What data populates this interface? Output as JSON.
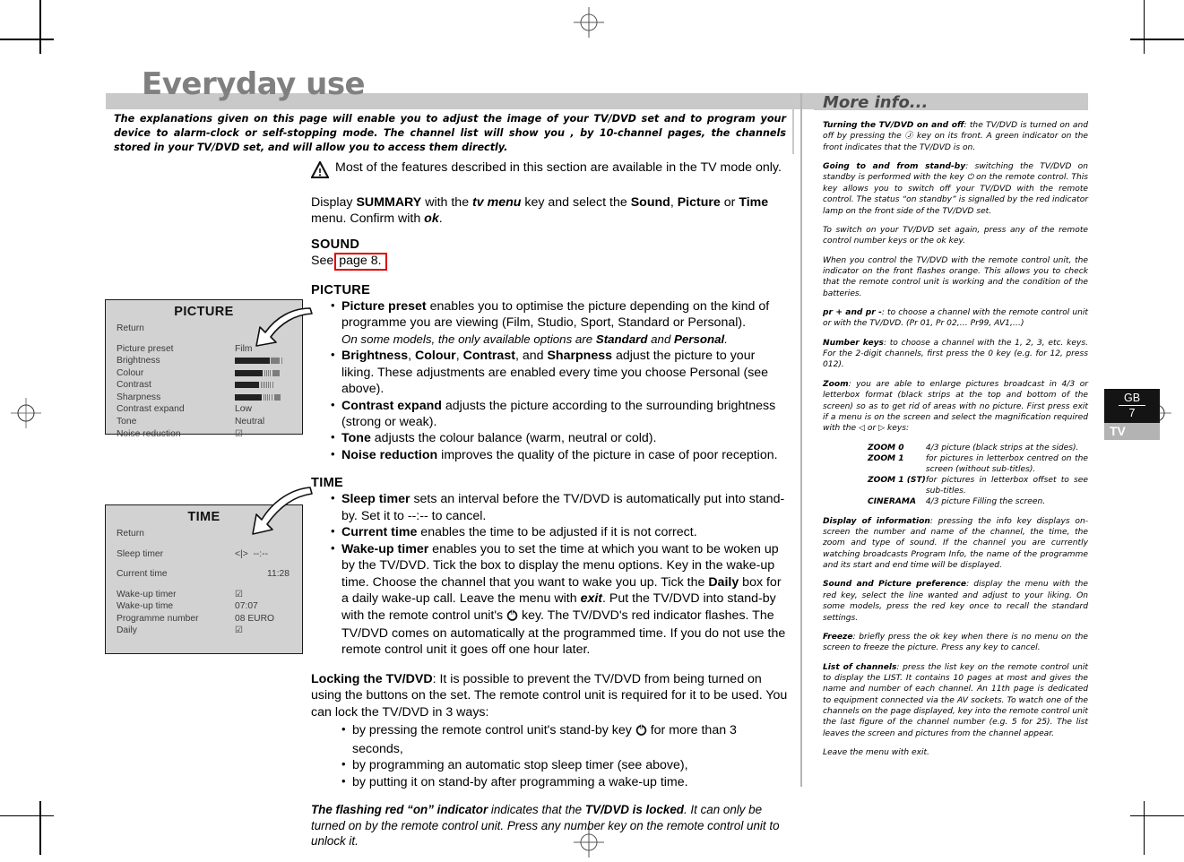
{
  "header": {
    "title": "Everyday use",
    "intro": "The explanations given on this page will enable you to adjust the image of your TV/DVD set and to program your device to alarm-clock or self-stopping mode.  The channel list will show you , by 10-channel pages, the channels stored in your TV/DVD set, and will allow you to access them directly."
  },
  "main": {
    "warning": "Most of the features described in this section are available in the TV mode only.",
    "display_line": {
      "p1": "Display ",
      "b1": "SUMMARY",
      "p2": " with the ",
      "b2": "tv menu",
      "p3": " key and select the ",
      "b3": "Sound",
      "p4": ", ",
      "b4": "Picture",
      "p5": " or ",
      "b5": "Time",
      "p6": " menu. Confirm with ",
      "b6": "ok",
      "p7": "."
    },
    "sound": {
      "heading": "SOUND",
      "see_prefix": "See",
      "ref": "page 8.",
      "ref_highlight_color": "#e00000"
    },
    "picture": {
      "heading": "PICTURE",
      "bullets": [
        {
          "bold": "Picture preset",
          "text": " enables you to optimise the picture depending on the kind of programme you are viewing (Film, Studio, Sport, Standard or Personal).",
          "note_pre": "On some models, the only available options are ",
          "note_b1": "Standard",
          "note_mid": " and ",
          "note_b2": "Personal",
          "note_post": "."
        },
        {
          "bold": "Brightness",
          "bold2": "Colour",
          "bold3": "Contrast",
          "bold4": "Sharpness",
          "text": " adjust the picture to your liking. These adjustments are enabled every time you choose Personal (see above)."
        },
        {
          "bold": "Contrast expand",
          "text": " adjusts the picture according to the surrounding brightness (strong or weak)."
        },
        {
          "bold": "Tone",
          "text": " adjusts the colour balance (warm, neutral or cold)."
        },
        {
          "bold": "Noise reduction",
          "text": " improves the quality of the picture in case of poor reception."
        }
      ]
    },
    "time": {
      "heading": "TIME",
      "bullets": [
        {
          "bold": "Sleep timer",
          "text": " sets an interval before the TV/DVD is automatically put into stand-by. Set it to --:-- to cancel."
        },
        {
          "bold": "Current time",
          "text": " enables the time to be adjusted if it is not correct."
        },
        {
          "bold": "Wake-up timer",
          "t1": " enables you to set the time at which you want to be woken up by the TV/DVD. Tick the box to display the menu options. Key in the wake-up time. Choose the channel that you want to wake you up. Tick the ",
          "b2": "Daily",
          "t2": " box for a daily wake-up call. Leave the menu with ",
          "b3": "exit",
          "t3": ". Put the TV/DVD into stand-by with the remote control unit's ",
          "t4": " key. The TV/DVD's red indicator flashes. The TV/DVD comes on automatically at the programmed time. If you do not use the remote control unit it goes off one hour later."
        }
      ]
    },
    "locking": {
      "bold_head": "Locking the TV/DVD",
      "text": ": It is possible to prevent the TV/DVD from being turned on using the buttons on the set. The remote control unit is required for it to be used. You can lock the TV/DVD in 3 ways:",
      "ways": [
        {
          "pre": "by pressing the remote control unit's stand-by key ",
          "post": " for more than 3 seconds,"
        },
        {
          "pre": "by programming an automatic stop sleep timer (see above),",
          "post": ""
        },
        {
          "pre": "by putting it on stand-by after programming a wake-up time.",
          "post": ""
        }
      ]
    },
    "closing": {
      "b1": "The flashing red “on” indicator",
      "t1": " indicates that the ",
      "b2": "TV/DVD is locked",
      "t2": ". It can only be turned on by the remote control unit. Press any number key on the remote control unit to unlock it."
    }
  },
  "osd_picture": {
    "title": "PICTURE",
    "return_label": "Return",
    "rows": [
      {
        "label": "Picture preset",
        "value": "Film",
        "type": "text"
      },
      {
        "label": "Brightness",
        "value": "",
        "type": "bar",
        "fill": 72,
        "ticks": 0
      },
      {
        "label": "Colour",
        "value": "",
        "type": "bar",
        "fill": 58,
        "ticks": 7
      },
      {
        "label": "Contrast",
        "value": "",
        "type": "bar",
        "fill": 50,
        "ticks": 8
      },
      {
        "label": "Sharpness",
        "value": "",
        "type": "bar",
        "fill": 56,
        "ticks": 7
      },
      {
        "label": "Contrast expand",
        "value": "Low",
        "type": "text"
      },
      {
        "label": "Tone",
        "value": "Neutral",
        "type": "text"
      },
      {
        "label": "Noise reduction",
        "value": "☑",
        "type": "check"
      }
    ]
  },
  "osd_time": {
    "title": "TIME",
    "return_label": "Return",
    "rows": [
      {
        "label": "Sleep timer",
        "value": "--:--",
        "prefix": "<|>"
      },
      {
        "label": "Current time",
        "value": "11:28",
        "prefix": ""
      },
      {
        "label": "Wake-up timer",
        "value": "☑",
        "prefix": ""
      },
      {
        "label": "Wake-up time",
        "value": "07:07",
        "prefix": ""
      },
      {
        "label": "Programme number",
        "value": "08 EURO",
        "prefix": ""
      },
      {
        "label": "Daily",
        "value": "☑",
        "prefix": ""
      }
    ]
  },
  "rail": {
    "title": "More info...",
    "blocks": [
      {
        "b": "Turning the TV/DVD on and off",
        "t": ": the TV/DVD is turned on and off by pressing the Ⓙ key on its front.\n A green indicator on the front indicates that the TV/DVD is on."
      },
      {
        "b": "Going to and from stand-by",
        "t": ": switching the TV/DVD on standby is performed with the key ⏻ on the remote control. This key allows you to switch off your TV/DVD with the remote control. The status “on standby” is signalled by the red indicator lamp on the front side of the TV/DVD set."
      },
      {
        "b": "",
        "t": "To switch on your TV/DVD set again, press any of the remote control number keys or the ok key."
      },
      {
        "b": "",
        "t": "When you control the TV/DVD with the remote control unit, the indicator on the front flashes orange. This allows you to check that the remote control unit is working and the condition of the batteries."
      },
      {
        "b": "pr + and pr -",
        "t": ": to choose a channel with the remote control unit or with the TV/DVD. (Pr 01, Pr 02,… Pr99, AV1,…)"
      },
      {
        "b": "Number keys",
        "t": ": to choose a channel with the 1, 2, 3, etc. keys. For the 2-digit channels, first press the 0 key (e.g. for 12, press 012)."
      },
      {
        "b": "Zoom",
        "t": ": you are able to enlarge pictures broadcast in 4/3 or letterbox format (black strips at the top and bottom of the screen) so as to get rid of areas with no picture. First press exit if a menu is on the screen and select the magnification required with the ◁ or ▷ keys:"
      }
    ],
    "zoom_table": [
      {
        "k": "ZOOM 0",
        "v": "4/3 picture (black strips at the sides)."
      },
      {
        "k": "ZOOM 1",
        "v": "for pictures in letterbox centred on the screen (without sub-titles)."
      },
      {
        "k": "ZOOM 1 (ST)",
        "v": "for pictures in letterbox offset to see sub-titles."
      },
      {
        "k": "CINERAMA",
        "v": "4/3 picture Filling the screen."
      }
    ],
    "blocks2": [
      {
        "b": "Display of information",
        "t": ": pressing the info key displays on-screen the number and name of the channel, the time, the zoom and type of sound. If the channel you are currently watching broadcasts Program Info, the name of the programme and its start and end time will be displayed."
      },
      {
        "b": "Sound and Picture preference",
        "t": ": display the menu with the red key, select the line wanted and adjust to your liking. On some models, press the red key once to recall the standard settings."
      },
      {
        "b": "Freeze",
        "t": ": briefly press the ok key when there is no menu on the screen to freeze the picture. Press any key to cancel."
      },
      {
        "b": "List of channels",
        "t": ": press the list key on the remote control unit to display the LIST. It contains 10 pages at most and gives the name and number of each channel. An 11th page is dedicated to equipment connected via the AV sockets.\nTo watch one of the channels on the page displayed, key into the remote control unit the last figure of the channel number (e.g. 5 for 25). The list leaves the screen and pictures from the channel appear."
      },
      {
        "b": "",
        "t": "Leave the menu with exit."
      }
    ]
  },
  "page_tab": {
    "country": "GB",
    "number": "7",
    "mode": "TV"
  }
}
